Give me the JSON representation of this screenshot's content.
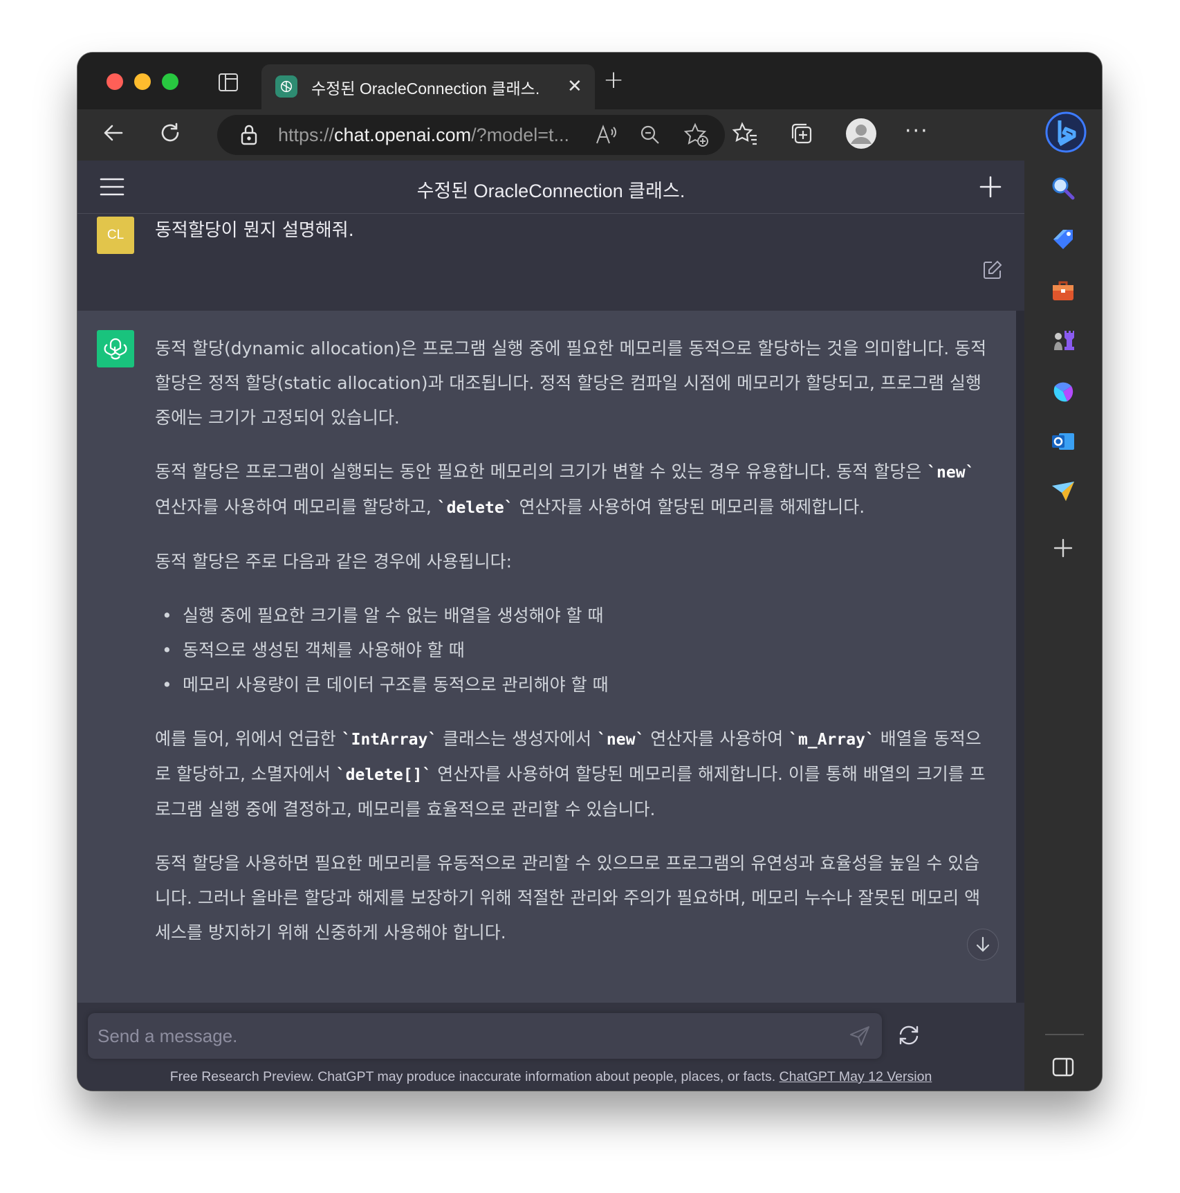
{
  "browser": {
    "tab_title": "수정된 OracleConnection 클래스.",
    "url_prefix": "https://",
    "url_host": "chat.openai.com",
    "url_rest": "/?model=t..."
  },
  "app": {
    "header_title": "수정된 OracleConnection 클래스.",
    "user_initials": "CL",
    "user_message": "동적할당이 뭔지 설명해줘."
  },
  "answer": {
    "p1": "동적 할당(dynamic allocation)은 프로그램 실행 중에 필요한 메모리를 동적으로 할당하는 것을 의미합니다. 동적 할당은 정적 할당(static allocation)과 대조됩니다. 정적 할당은 컴파일 시점에 메모리가 할당되고, 프로그램 실행 중에는 크기가 고정되어 있습니다.",
    "p2_a": "동적 할당은 프로그램이 실행되는 동안 필요한 메모리의 크기가 변할 수 있는 경우 유용합니다. 동적 할당은 ",
    "p2_code1": "`new`",
    "p2_b": " 연산자를 사용하여 메모리를 할당하고, ",
    "p2_code2": "`delete`",
    "p2_c": " 연산자를 사용하여 할당된 메모리를 해제합니다.",
    "p3": "동적 할당은 주로 다음과 같은 경우에 사용됩니다:",
    "bullets": [
      "실행 중에 필요한 크기를 알 수 없는 배열을 생성해야 할 때",
      "동적으로 생성된 객체를 사용해야 할 때",
      "메모리 사용량이 큰 데이터 구조를 동적으로 관리해야 할 때"
    ],
    "p4_a": "예를 들어, 위에서 언급한 ",
    "p4_code1": "`IntArray`",
    "p4_b": " 클래스는 생성자에서 ",
    "p4_code2": "`new`",
    "p4_c": " 연산자를 사용하여 ",
    "p4_code3": "`m_Array`",
    "p4_d": " 배열을 동적으로 할당하고, 소멸자에서 ",
    "p4_code4": "`delete[]`",
    "p4_e": " 연산자를 사용하여 할당된 메모리를 해제합니다. 이를 통해 배열의 크기를 프로그램 실행 중에 결정하고, 메모리를 효율적으로 관리할 수 있습니다.",
    "p5": "동적 할당을 사용하면 필요한 메모리를 유동적으로 관리할 수 있으므로 프로그램의 유연성과 효율성을 높일 수 있습니다. 그러나 올바른 할당과 해제를 보장하기 위해 적절한 관리와 주의가 필요하며, 메모리 누수나 잘못된 메모리 액세스를 방지하기 위해 신중하게 사용해야 합니다."
  },
  "composer": {
    "placeholder": "Send a message."
  },
  "footer": {
    "text": "Free Research Preview. ChatGPT may produce inaccurate information about people, places, or facts. ",
    "link": "ChatGPT May 12 Version"
  },
  "colors": {
    "page_bg": "#343541",
    "assistant_bg": "#444654",
    "user_avatar": "#e2c54b",
    "bot_avatar": "#19c37d"
  },
  "icons": {
    "sidebar": [
      "search-icon",
      "tag-icon",
      "briefcase-icon",
      "chess-icon",
      "copilot-icon",
      "outlook-icon",
      "paper-plane-icon",
      "plus-icon",
      "split-screen-icon",
      "gear-icon"
    ]
  }
}
